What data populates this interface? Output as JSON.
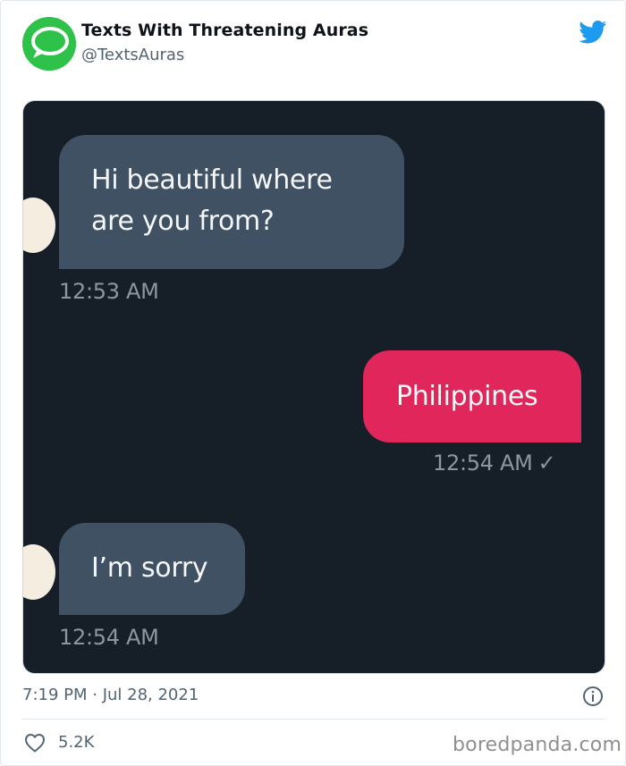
{
  "author": {
    "name": "Texts With Threatening Auras",
    "handle": "@TextsAuras",
    "avatar_icon": "chat-bubble-icon",
    "avatar_color": "#2fc24a"
  },
  "platform_icon": "twitter-bird-icon",
  "brand_color": "#1d9bf0",
  "conversation": {
    "messages": [
      {
        "direction": "incoming",
        "text_line1": "Hi beautiful where",
        "text_line2": "are you from?",
        "time": "12:53 AM"
      },
      {
        "direction": "outgoing",
        "text": "Philippines",
        "time": "12:54 AM",
        "status_icon": "checkmark-icon"
      },
      {
        "direction": "incoming",
        "text": "I’m sorry",
        "time": "12:54 AM"
      }
    ],
    "colors": {
      "background": "#161f28",
      "incoming": "#3f5163",
      "outgoing": "#e0265a"
    }
  },
  "tweet_meta": {
    "timestamp": "7:19 PM · Jul 28, 2021",
    "info_icon": "info-icon"
  },
  "engagement": {
    "likes": "5.2K",
    "like_icon": "heart-icon"
  },
  "watermark": "boredpanda.com"
}
